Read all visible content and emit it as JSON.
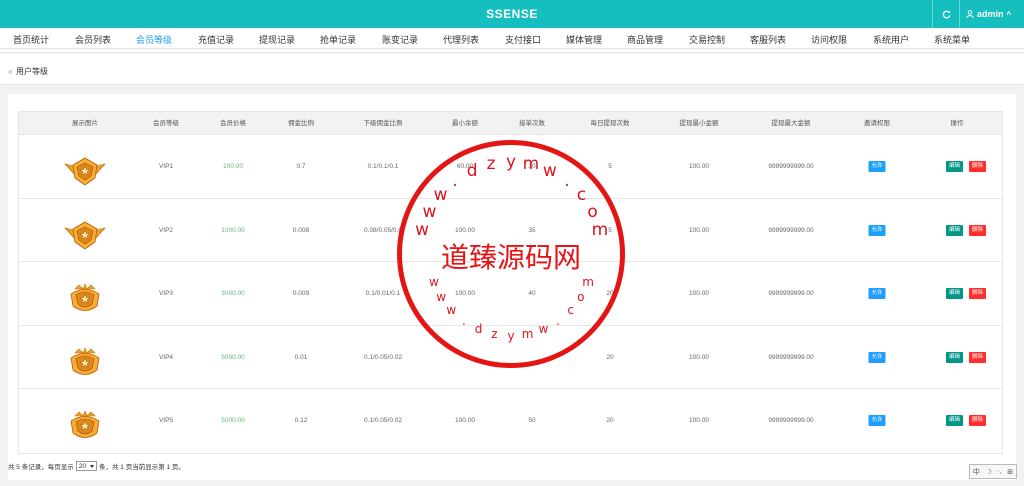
{
  "header": {
    "brand": "SSENSE",
    "refresh_icon": "refresh-icon",
    "user_icon": "user-icon",
    "user_name": "admin",
    "user_caret": "^"
  },
  "menu": [
    {
      "label": "首页统计"
    },
    {
      "label": "会员列表"
    },
    {
      "label": "会员等级",
      "active": true
    },
    {
      "label": "充值记录"
    },
    {
      "label": "提现记录"
    },
    {
      "label": "抢单记录"
    },
    {
      "label": "账变记录"
    },
    {
      "label": "代理列表"
    },
    {
      "label": "支付接口"
    },
    {
      "label": "媒体管理"
    },
    {
      "label": "商品管理"
    },
    {
      "label": "交易控制"
    },
    {
      "label": "客服列表"
    },
    {
      "label": "访问权限"
    },
    {
      "label": "系统用户"
    },
    {
      "label": "系统菜单"
    }
  ],
  "breadcrumb": {
    "arrow": "»",
    "current": "用户等级"
  },
  "table": {
    "columns": [
      "展示图片",
      "会员等级",
      "会员价格",
      "佣金比例",
      "下级佣金比例",
      "最小余额",
      "接单次数",
      "每日提现次数",
      "提现最小金额",
      "提现最大金额",
      "邀请权限",
      "操作"
    ],
    "rows": [
      {
        "badge": "gold-wing-star-badge-icon",
        "level": "VIP1",
        "price": "100.00",
        "commission": "0.7",
        "sub_commission": "0.1/0.1/0.1",
        "min_balance": "60.00",
        "orders": "30",
        "daily_withdraw": "5",
        "withdraw_min": "100.00",
        "withdraw_max": "9999999999.00",
        "invite": "允许",
        "edit": "编辑",
        "delete": "删除"
      },
      {
        "badge": "gold-wing-star-badge-icon",
        "level": "VIP2",
        "price": "1000.00",
        "commission": "0.008",
        "sub_commission": "0.08/0.05/0.0",
        "min_balance": "100.00",
        "orders": "35",
        "daily_withdraw": "5",
        "withdraw_min": "100.00",
        "withdraw_max": "9999999999.00",
        "invite": "允许",
        "edit": "编辑",
        "delete": "删除"
      },
      {
        "badge": "gold-crown-star-badge-icon",
        "level": "VIP3",
        "price": "3000.00",
        "commission": "0.009",
        "sub_commission": "0.1/0.01/0.1",
        "min_balance": "100.00",
        "orders": "40",
        "daily_withdraw": "20",
        "withdraw_min": "100.00",
        "withdraw_max": "9999999999.00",
        "invite": "允许",
        "edit": "编辑",
        "delete": "删除"
      },
      {
        "badge": "gold-crown-star-badge-icon",
        "level": "VIP4",
        "price": "5000.00",
        "commission": "0.01",
        "sub_commission": "0.1/0.05/0.02",
        "min_balance": "",
        "orders": "",
        "daily_withdraw": "20",
        "withdraw_min": "100.00",
        "withdraw_max": "9999999999.00",
        "invite": "允许",
        "edit": "编辑",
        "delete": "删除"
      },
      {
        "badge": "gold-crown-star-badge-icon",
        "level": "VIP5",
        "price": "5000.00",
        "commission": "0.12",
        "sub_commission": "0.1/0.05/0.02",
        "min_balance": "100.00",
        "orders": "50",
        "daily_withdraw": "20",
        "withdraw_min": "100.00",
        "withdraw_max": "9999999999.00",
        "invite": "允许",
        "edit": "编辑",
        "delete": "删除"
      }
    ]
  },
  "pager": {
    "before": "共 5 条记录，每页显示",
    "page_size": "20",
    "after": "条，共 1 页当前显示第 1 页。"
  },
  "ime": {
    "lang": "中",
    "moon": "☽",
    "punct": "·,",
    "grid": "⊞"
  },
  "watermark": {
    "center": "道臻源码网",
    "top_chars": [
      "w",
      "w",
      "w",
      ".",
      "d",
      "z",
      "y",
      "m",
      "w",
      ".",
      "c",
      "o",
      "m"
    ],
    "bottom_chars": [
      "w",
      "w",
      "w",
      ".",
      "d",
      "z",
      "y",
      "m",
      "w",
      ".",
      "c",
      "o",
      "m"
    ],
    "color": "#e31515"
  },
  "colors": {
    "header": "#15bfbf",
    "active": "#1e9fff",
    "price": "#5fb878",
    "edit": "#009688",
    "delete": "#ff2d2d"
  }
}
